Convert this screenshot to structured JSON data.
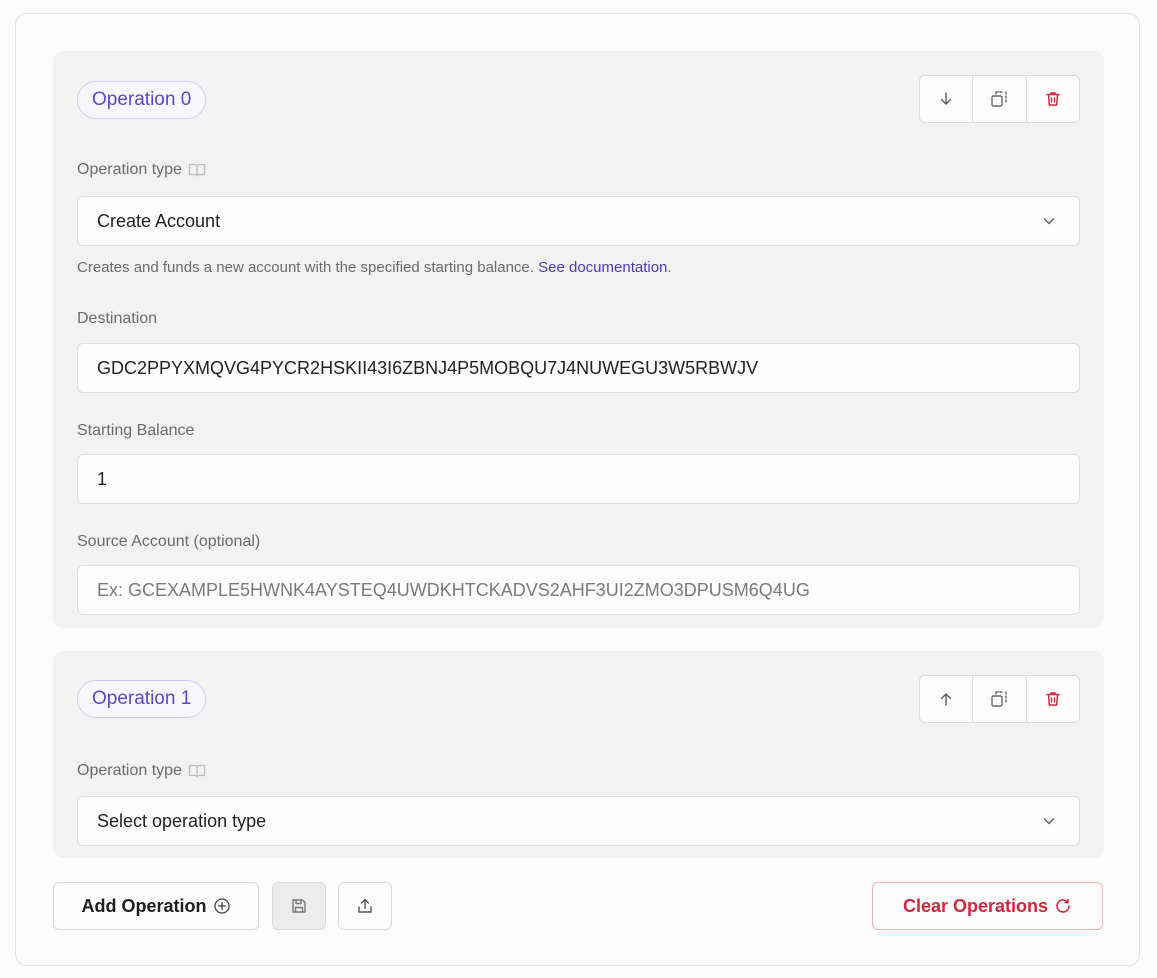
{
  "operations": [
    {
      "badge": "Operation 0",
      "move_icon": "arrow-down-icon",
      "type_label": "Operation type",
      "type_value": "Create Account",
      "help_text": "Creates and funds a new account with the specified starting balance. ",
      "help_link": "See documentation",
      "help_end": ".",
      "fields": [
        {
          "label": "Destination",
          "value": "GDC2PPYXMQVG4PYCR2HSKII43I6ZBNJ4P5MOBQU7J4NUWEGU3W5RBWJV"
        },
        {
          "label": "Starting Balance",
          "value": "1"
        },
        {
          "label": "Source Account (optional)",
          "placeholder": "Ex: GCEXAMPLE5HWNK4AYSTEQ4UWDKHTCKADVS2AHF3UI2ZMO3DPUSM6Q4UG"
        }
      ]
    },
    {
      "badge": "Operation 1",
      "move_icon": "arrow-up-icon",
      "type_label": "Operation type",
      "type_value": "Select operation type"
    }
  ],
  "footer": {
    "add_label": "Add Operation",
    "clear_label": "Clear Operations"
  },
  "colors": {
    "accent": "#5b47c5",
    "danger": "#d0253b",
    "card_bg": "#f2f2f2"
  }
}
